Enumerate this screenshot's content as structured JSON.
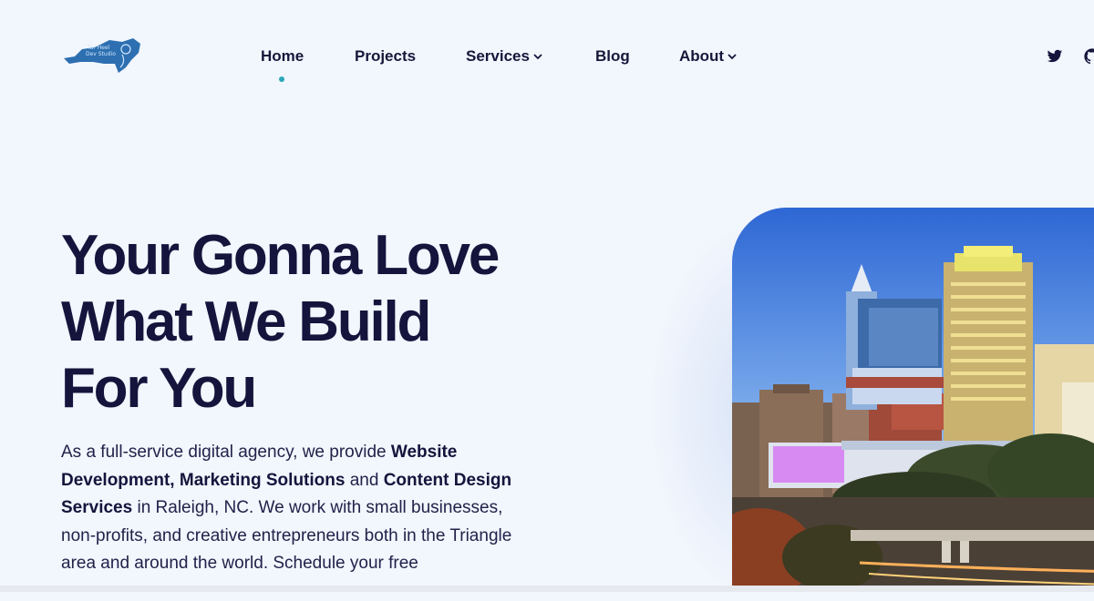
{
  "logo": {
    "line1": "Tar Heel",
    "line2": "Dev Studio"
  },
  "nav": {
    "items": [
      {
        "label": "Home",
        "has_dropdown": false,
        "active": true
      },
      {
        "label": "Projects",
        "has_dropdown": false
      },
      {
        "label": "Services",
        "has_dropdown": true
      },
      {
        "label": "Blog",
        "has_dropdown": false
      },
      {
        "label": "About",
        "has_dropdown": true
      }
    ]
  },
  "social": {
    "icons": [
      "twitter-icon",
      "github-icon"
    ]
  },
  "hero": {
    "title_line1": "Your Gonna Love",
    "title_line2": "What We Build",
    "title_line3": "For You",
    "p_intro": "As a full-service digital agency, we provide ",
    "b_website": "Website Development, Marketing Solutions",
    "p_and": " and ",
    "b_content": "Content Design Services",
    "p_rest": " in Raleigh, NC. We work with small businesses, non-profits, and creative entrepreneurs both in the Triangle area and around the world. Schedule your free"
  },
  "colors": {
    "background": "#f2f6fd",
    "text": "#14143c",
    "accent": "#2aa7b8",
    "logo": "#2d6fb0"
  }
}
